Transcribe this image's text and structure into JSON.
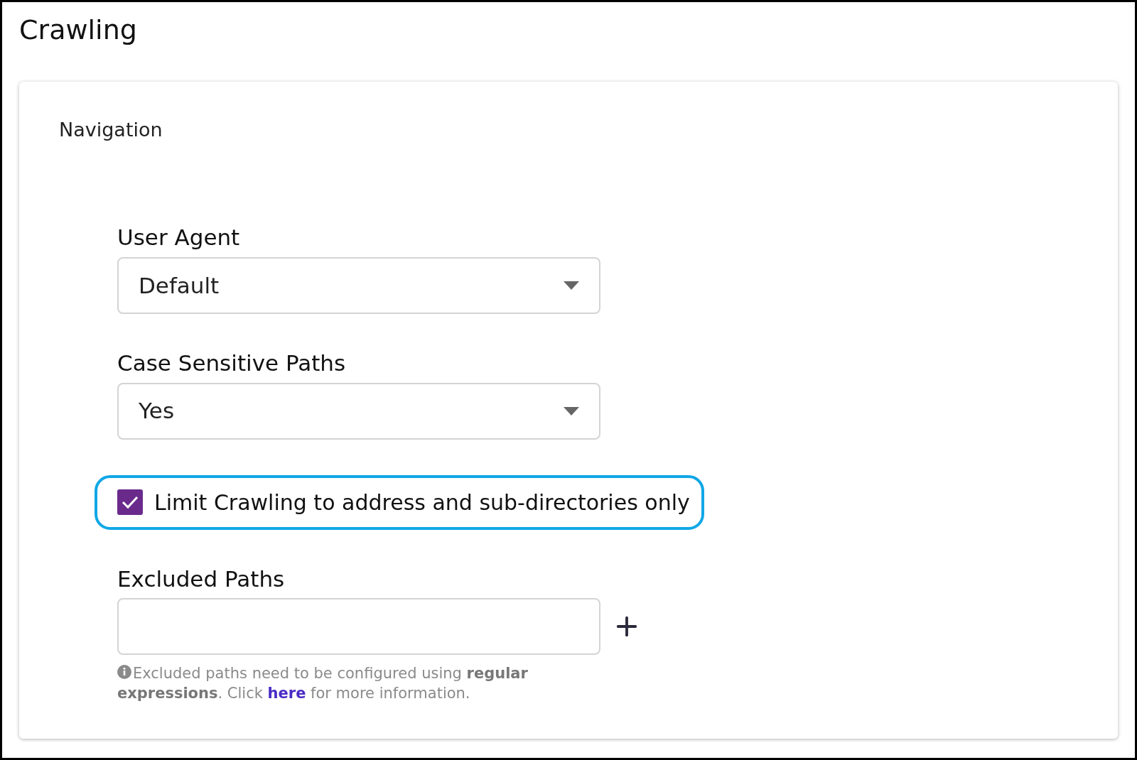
{
  "page": {
    "title": "Crawling"
  },
  "section": {
    "title": "Navigation"
  },
  "fields": [
    {
      "kind": "select",
      "label": "User Agent",
      "value": "Default"
    },
    {
      "kind": "select",
      "label": "Case Sensitive Paths",
      "value": "Yes"
    },
    {
      "kind": "checkbox",
      "label": "Limit Crawling to address and sub-directories only",
      "checked": true,
      "highlighted": true
    },
    {
      "kind": "text",
      "label": "Excluded Paths",
      "help": {
        "before": "Excluded paths need to be configured using **regular expressions**. Click ",
        "link": "here",
        "after": " for more information."
      }
    }
  ]
}
